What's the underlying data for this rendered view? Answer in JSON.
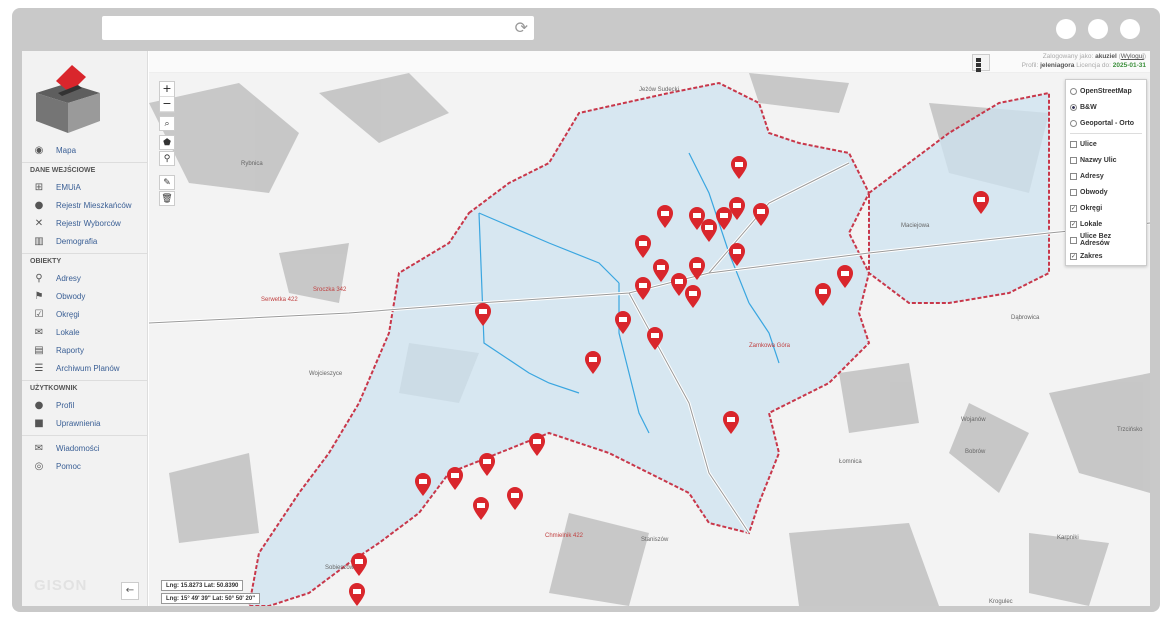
{
  "browser": {
    "reload_icon": "reload-icon"
  },
  "sidebar": {
    "brand": "GISON",
    "items_main": [
      {
        "label": "Mapa",
        "icon": "globe-icon"
      }
    ],
    "section_input": "DANE WEJŚCIOWE",
    "items_input": [
      {
        "label": "EMUiA",
        "icon": "network-icon"
      },
      {
        "label": "Rejestr Mieszkańców",
        "icon": "users-icon"
      },
      {
        "label": "Rejestr Wyborców",
        "icon": "user-x-icon"
      },
      {
        "label": "Demografia",
        "icon": "bar-chart-icon"
      }
    ],
    "section_objects": "OBIEKTY",
    "items_objects": [
      {
        "label": "Adresy",
        "icon": "map-pin-icon"
      },
      {
        "label": "Obwody",
        "icon": "flag-icon"
      },
      {
        "label": "Okręgi",
        "icon": "check-square-icon"
      },
      {
        "label": "Lokale",
        "icon": "envelope-icon"
      },
      {
        "label": "Raporty",
        "icon": "document-icon"
      },
      {
        "label": "Archiwum Planów",
        "icon": "list-icon"
      }
    ],
    "section_user": "UŻYTKOWNIK",
    "items_user": [
      {
        "label": "Profil",
        "icon": "user-icon"
      },
      {
        "label": "Uprawnienia",
        "icon": "lock-icon"
      }
    ],
    "items_extra": [
      {
        "label": "Wiadomości",
        "icon": "message-icon"
      },
      {
        "label": "Pomoc",
        "icon": "help-icon"
      }
    ],
    "collapse_icon": "arrow-left-icon"
  },
  "topbar": {
    "logged_as": "Zalogowany jako:",
    "username": "akuziel",
    "logout": "Wyloguj",
    "profile_label": "Profil:",
    "profile": "jeleniagora",
    "license_label": "Licencja do:",
    "license_date": "2025-01-31"
  },
  "map": {
    "zoom_in": "+",
    "zoom_out": "−",
    "layers": {
      "base": [
        {
          "label": "OpenStreetMap",
          "selected": false
        },
        {
          "label": "B&W",
          "selected": true
        },
        {
          "label": "Geoportal - Orto",
          "selected": false
        }
      ],
      "overlays": [
        {
          "label": "Ulice",
          "checked": false
        },
        {
          "label": "Nazwy Ulic",
          "checked": false
        },
        {
          "label": "Adresy",
          "checked": false
        },
        {
          "label": "Obwody",
          "checked": false
        },
        {
          "label": "Okręgi",
          "checked": true
        },
        {
          "label": "Lokale",
          "checked": true
        },
        {
          "label": "Ulice Bez Adresów",
          "checked": false
        },
        {
          "label": "Zakres",
          "checked": true
        }
      ]
    },
    "coords_decimal": "Lng: 15.8273 Lat: 50.8390",
    "coords_dms": "Lng: 15° 49' 39\" Lat: 50° 50' 20\"",
    "labels": [
      "Jeżów Sudecki",
      "Rybnica",
      "Maciejowa",
      "Dąbrowica",
      "Wojcieszyce",
      "Sroczka 342",
      "Serwetka 422",
      "Wojanów",
      "Bobrów",
      "Łomnica",
      "Trzcińsko",
      "Staniszów",
      "Chmielnik 422",
      "Karpniki",
      "Krogulec",
      "Sobieszów",
      "Zamkowa Góra"
    ],
    "colors": {
      "zone": "#cde3f0",
      "border": "#c8374a",
      "pin": "#d9262c",
      "district_line": "#3aa6e0"
    }
  }
}
